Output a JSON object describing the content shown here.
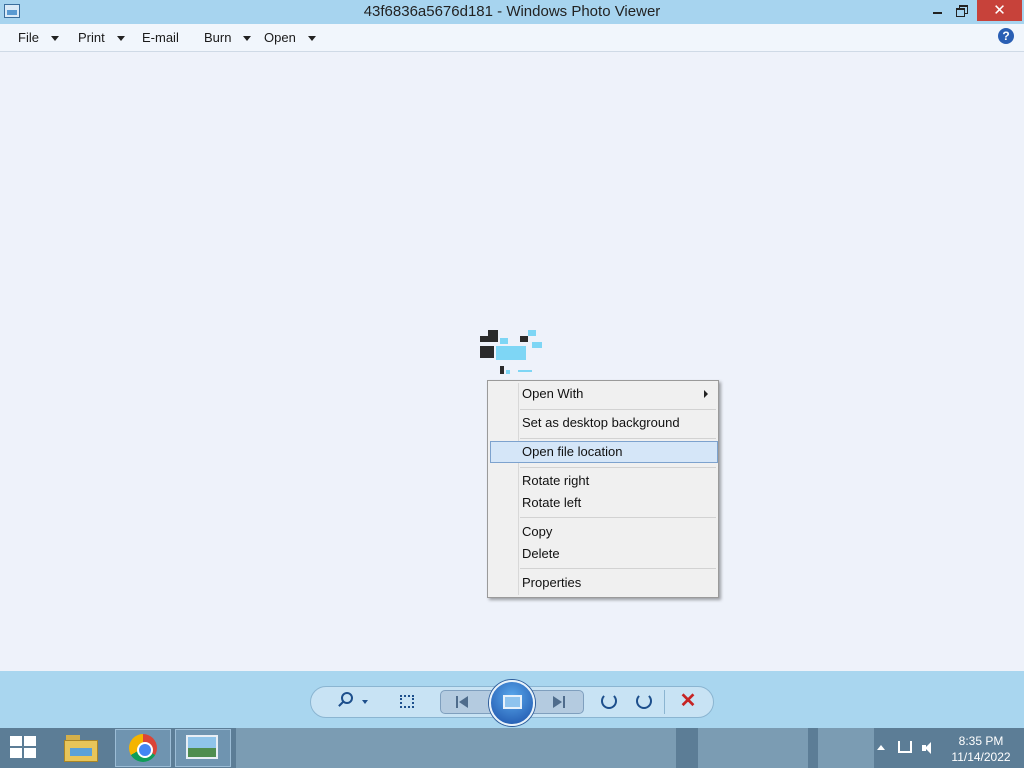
{
  "window": {
    "title": "43f6836a5676d181 - Windows Photo Viewer",
    "close_glyph": "✕"
  },
  "menu": {
    "file": "File",
    "print": "Print",
    "email": "E-mail",
    "burn": "Burn",
    "open": "Open",
    "help_glyph": "?"
  },
  "context_menu": {
    "items": [
      {
        "label": "Open With",
        "has_submenu": true
      },
      {
        "label": "Set as desktop background"
      },
      {
        "label": "Open file location",
        "highlighted": true
      },
      {
        "label": "Rotate right"
      },
      {
        "label": "Rotate left"
      },
      {
        "label": "Copy"
      },
      {
        "label": "Delete"
      },
      {
        "label": "Properties"
      }
    ]
  },
  "controls": {
    "delete_glyph": "✕"
  },
  "taskbar": {
    "time": "8:35 PM",
    "date": "11/14/2022"
  },
  "colors": {
    "titlebar": "#a7d4ef",
    "close_button": "#c7423a",
    "canvas": "#eef2fa",
    "menu_highlight": "#d5e6f8",
    "taskbar": "#5c7d96"
  },
  "icons": [
    "photo-viewer-app-icon",
    "minimize-icon",
    "maximize-icon",
    "close-icon",
    "help-icon",
    "zoom-icon",
    "fit-to-window-icon",
    "previous-icon",
    "slideshow-icon",
    "next-icon",
    "rotate-left-icon",
    "rotate-right-icon",
    "delete-icon",
    "windows-start-icon",
    "file-explorer-icon",
    "chrome-icon",
    "photo-viewer-icon",
    "network-icon",
    "volume-icon"
  ]
}
